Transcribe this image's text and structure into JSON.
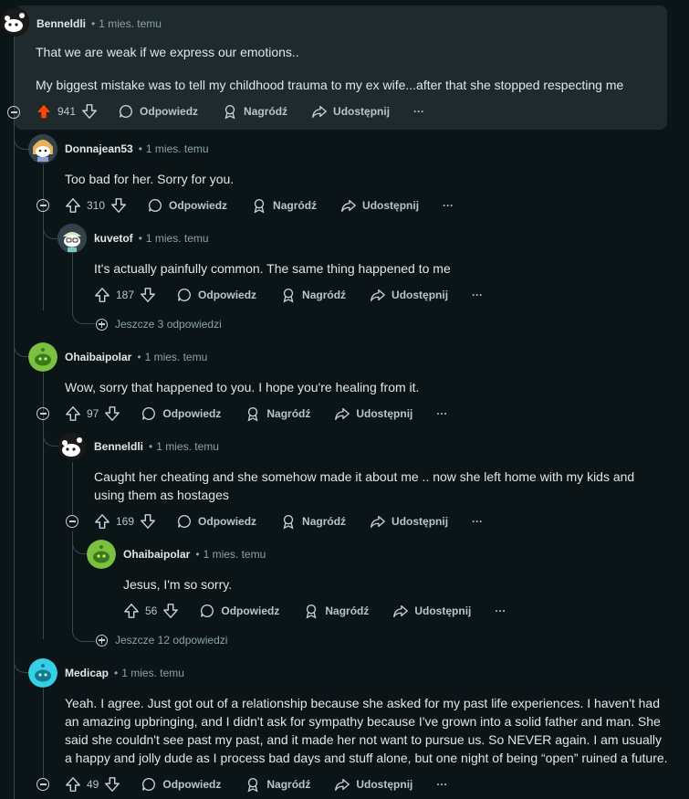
{
  "labels": {
    "reply": "Odpowiedz",
    "award": "Nagródź",
    "share": "Udostępnij",
    "more": "···"
  },
  "colors": {
    "upvoted": "#ff4500",
    "background": "#0b1416",
    "highlight": "#1e2a2e"
  },
  "comments": [
    {
      "author": "Benneldli",
      "time": "1 mies. temu",
      "text": "That we are weak if we express our emotions..",
      "text2": "My biggest mistake was to tell my childhood trauma to my ex wife...after that she stopped respecting me",
      "score": "941",
      "upvoted": true,
      "avatar": "snoo-white"
    },
    {
      "author": "Donnajean53",
      "time": "1 mies. temu",
      "text": "Too bad for her. Sorry for you.",
      "score": "310",
      "avatar": "snoo-blonde"
    },
    {
      "author": "kuvetof",
      "time": "1 mies. temu",
      "text": "It's actually painfully common. The same thing happened to me",
      "score": "187",
      "avatar": "snoo-mint"
    },
    {
      "author": "Ohaibaipolar",
      "time": "1 mies. temu",
      "text": "Wow, sorry that happened to you. I hope you're healing from it.",
      "score": "97",
      "avatar": "snoo-green"
    },
    {
      "author": "Benneldli",
      "time": "1 mies. temu",
      "text": "Caught her cheating and she somehow made it about me .. now she left home with my kids and using them as hostages",
      "score": "169",
      "avatar": "snoo-white"
    },
    {
      "author": "Ohaibaipolar",
      "time": "1 mies. temu",
      "text": "Jesus, I'm so sorry.",
      "score": "56",
      "avatar": "snoo-green"
    },
    {
      "author": "Medicap",
      "time": "1 mies. temu",
      "text": "Yeah. I agree. Just got out of a relationship because she asked for my past life experiences. I haven't had an amazing upbringing, and I didn't ask for sympathy because I've grown into a solid father and man. She said she couldn't see past my past, and it made her not want to pursue us. So NEVER again. I am usually a happy and jolly dude as I process bad days and stuff alone, but one night of being “open” ruined a future.",
      "score": "49",
      "avatar": "snoo-cyan"
    }
  ],
  "more_replies": [
    "Jeszcze 3 odpowiedzi",
    "Jeszcze 12 odpowiedzi"
  ]
}
